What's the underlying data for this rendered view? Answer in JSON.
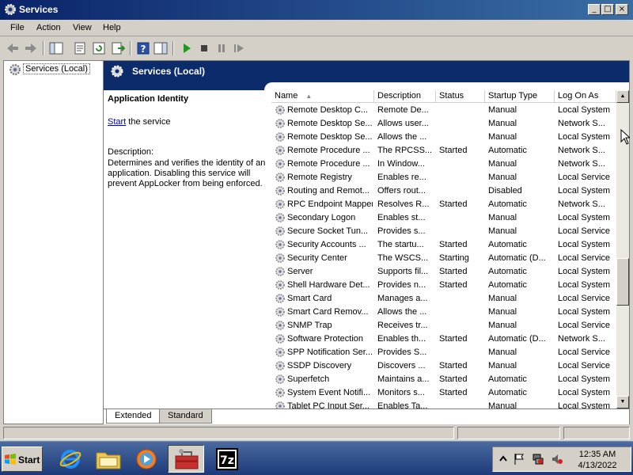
{
  "window": {
    "title": "Services"
  },
  "menu": {
    "file": "File",
    "action": "Action",
    "view": "View",
    "help": "Help"
  },
  "toolbar": {
    "icons": [
      "back-arrow-icon",
      "forward-arrow-icon",
      "show-hide-tree-icon",
      "properties-icon",
      "refresh-icon",
      "export-list-icon",
      "help-icon",
      "show-hide-action-pane-icon",
      "start-service-icon",
      "stop-service-icon",
      "pause-service-icon",
      "restart-service-icon"
    ]
  },
  "tree": {
    "root": "Services (Local)"
  },
  "panel": {
    "title": "Services (Local)"
  },
  "details": {
    "service_name": "Application Identity",
    "start_link": "Start",
    "start_suffix": " the service",
    "description_label": "Description:",
    "description": "Determines and verifies the identity of an application. Disabling this service will prevent AppLocker from being enforced."
  },
  "columns": {
    "name": "Name",
    "description": "Description",
    "status": "Status",
    "startup_type": "Startup Type",
    "log_on_as": "Log On As"
  },
  "services": [
    {
      "name": "Remote Desktop C...",
      "description": "Remote De...",
      "status": "",
      "startup": "Manual",
      "logon": "Local System"
    },
    {
      "name": "Remote Desktop Se...",
      "description": "Allows user...",
      "status": "",
      "startup": "Manual",
      "logon": "Network S..."
    },
    {
      "name": "Remote Desktop Se...",
      "description": "Allows the ...",
      "status": "",
      "startup": "Manual",
      "logon": "Local System"
    },
    {
      "name": "Remote Procedure ...",
      "description": "The RPCSS...",
      "status": "Started",
      "startup": "Automatic",
      "logon": "Network S..."
    },
    {
      "name": "Remote Procedure ...",
      "description": "In Window...",
      "status": "",
      "startup": "Manual",
      "logon": "Network S..."
    },
    {
      "name": "Remote Registry",
      "description": "Enables re...",
      "status": "",
      "startup": "Manual",
      "logon": "Local Service"
    },
    {
      "name": "Routing and Remot...",
      "description": "Offers rout...",
      "status": "",
      "startup": "Disabled",
      "logon": "Local System"
    },
    {
      "name": "RPC Endpoint Mapper",
      "description": "Resolves R...",
      "status": "Started",
      "startup": "Automatic",
      "logon": "Network S..."
    },
    {
      "name": "Secondary Logon",
      "description": "Enables st...",
      "status": "",
      "startup": "Manual",
      "logon": "Local System"
    },
    {
      "name": "Secure Socket Tun...",
      "description": "Provides s...",
      "status": "",
      "startup": "Manual",
      "logon": "Local Service"
    },
    {
      "name": "Security Accounts ...",
      "description": "The startu...",
      "status": "Started",
      "startup": "Automatic",
      "logon": "Local System"
    },
    {
      "name": "Security Center",
      "description": "The WSCS...",
      "status": "Starting",
      "startup": "Automatic (D...",
      "logon": "Local Service"
    },
    {
      "name": "Server",
      "description": "Supports fil...",
      "status": "Started",
      "startup": "Automatic",
      "logon": "Local System"
    },
    {
      "name": "Shell Hardware Det...",
      "description": "Provides n...",
      "status": "Started",
      "startup": "Automatic",
      "logon": "Local System"
    },
    {
      "name": "Smart Card",
      "description": "Manages a...",
      "status": "",
      "startup": "Manual",
      "logon": "Local Service"
    },
    {
      "name": "Smart Card Remov...",
      "description": "Allows the ...",
      "status": "",
      "startup": "Manual",
      "logon": "Local System"
    },
    {
      "name": "SNMP Trap",
      "description": "Receives tr...",
      "status": "",
      "startup": "Manual",
      "logon": "Local Service"
    },
    {
      "name": "Software Protection",
      "description": "Enables th...",
      "status": "Started",
      "startup": "Automatic (D...",
      "logon": "Network S..."
    },
    {
      "name": "SPP Notification Ser...",
      "description": "Provides S...",
      "status": "",
      "startup": "Manual",
      "logon": "Local Service"
    },
    {
      "name": "SSDP Discovery",
      "description": "Discovers ...",
      "status": "Started",
      "startup": "Manual",
      "logon": "Local Service"
    },
    {
      "name": "Superfetch",
      "description": "Maintains a...",
      "status": "Started",
      "startup": "Automatic",
      "logon": "Local System"
    },
    {
      "name": "System Event Notifi...",
      "description": "Monitors s...",
      "status": "Started",
      "startup": "Automatic",
      "logon": "Local System"
    },
    {
      "name": "Tablet PC Input Ser...",
      "description": "Enables Ta...",
      "status": "",
      "startup": "Manual",
      "logon": "Local System"
    }
  ],
  "tabs": {
    "extended": "Extended",
    "standard": "Standard"
  },
  "taskbar": {
    "start": "Start",
    "apps": [
      "internet-explorer-icon",
      "windows-explorer-icon",
      "media-player-icon",
      "services-toolbox-icon",
      "7zip-icon"
    ],
    "tray_icons": [
      "show-hidden-icons",
      "action-center-flag-icon",
      "network-icon",
      "volume-muted-icon"
    ],
    "time": "12:35 AM",
    "date": "4/13/2022"
  }
}
